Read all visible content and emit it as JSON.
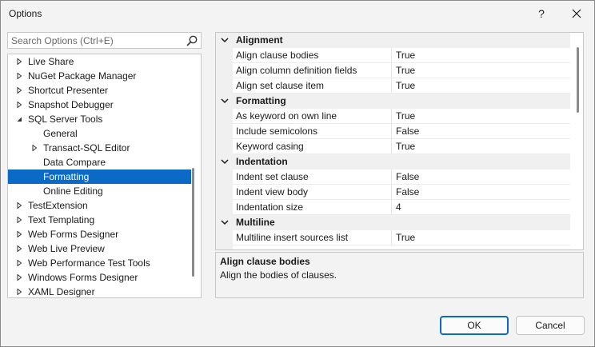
{
  "window": {
    "title": "Options",
    "help_label": "?",
    "close_label": "✕"
  },
  "search": {
    "placeholder": "Search Options (Ctrl+E)",
    "value": ""
  },
  "tree": {
    "items": [
      {
        "label": "Live Share",
        "expander": "collapsed",
        "level": 0
      },
      {
        "label": "NuGet Package Manager",
        "expander": "collapsed",
        "level": 0
      },
      {
        "label": "Shortcut Presenter",
        "expander": "collapsed",
        "level": 0
      },
      {
        "label": "Snapshot Debugger",
        "expander": "collapsed",
        "level": 0
      },
      {
        "label": "SQL Server Tools",
        "expander": "expanded",
        "level": 0
      },
      {
        "label": "General",
        "expander": "none",
        "level": 1
      },
      {
        "label": "Transact-SQL Editor",
        "expander": "collapsed",
        "level": 1
      },
      {
        "label": "Data Compare",
        "expander": "none",
        "level": 1
      },
      {
        "label": "Formatting",
        "expander": "none",
        "level": 1,
        "selected": true
      },
      {
        "label": "Online Editing",
        "expander": "none",
        "level": 1
      },
      {
        "label": "TestExtension",
        "expander": "collapsed",
        "level": 0
      },
      {
        "label": "Text Templating",
        "expander": "collapsed",
        "level": 0
      },
      {
        "label": "Web Forms Designer",
        "expander": "collapsed",
        "level": 0
      },
      {
        "label": "Web Live Preview",
        "expander": "collapsed",
        "level": 0
      },
      {
        "label": "Web Performance Test Tools",
        "expander": "collapsed",
        "level": 0
      },
      {
        "label": "Windows Forms Designer",
        "expander": "collapsed",
        "level": 0
      },
      {
        "label": "XAML Designer",
        "expander": "collapsed",
        "level": 0
      }
    ]
  },
  "grid": {
    "rows": [
      {
        "kind": "category",
        "label": "Alignment"
      },
      {
        "kind": "property",
        "name": "Align clause bodies",
        "value": "True"
      },
      {
        "kind": "property",
        "name": "Align column definition fields",
        "value": "True"
      },
      {
        "kind": "property",
        "name": "Align set clause item",
        "value": "True"
      },
      {
        "kind": "category",
        "label": "Formatting"
      },
      {
        "kind": "property",
        "name": "As keyword on own line",
        "value": "True"
      },
      {
        "kind": "property",
        "name": "Include semicolons",
        "value": "False"
      },
      {
        "kind": "property",
        "name": "Keyword casing",
        "value": "True"
      },
      {
        "kind": "category",
        "label": "Indentation"
      },
      {
        "kind": "property",
        "name": "Indent set clause",
        "value": "False"
      },
      {
        "kind": "property",
        "name": "Indent view body",
        "value": "False"
      },
      {
        "kind": "property",
        "name": "Indentation size",
        "value": "4"
      },
      {
        "kind": "category",
        "label": "Multiline"
      },
      {
        "kind": "property",
        "name": "Multiline insert sources list",
        "value": "True"
      }
    ]
  },
  "description": {
    "title": "Align clause bodies",
    "text": "Align the bodies of clauses."
  },
  "buttons": {
    "ok": "OK",
    "cancel": "Cancel"
  },
  "colors": {
    "selection": "#0a6ac6",
    "window_bg": "#f3f3f3",
    "category_bg": "#f0f0f0"
  },
  "icons": {
    "search": "search-icon",
    "expand": "triangle-right-icon",
    "collapse": "triangle-down-icon",
    "category": "chevron-down-icon"
  }
}
